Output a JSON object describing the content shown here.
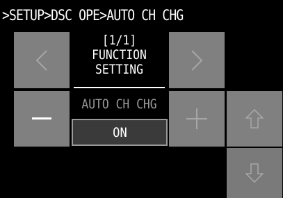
{
  "header": {
    "breadcrumb": ">SETUP>DSC OPE>AUTO CH CHG"
  },
  "page": {
    "indicator": "[1/1]",
    "title_line1": "FUNCTION",
    "title_line2": "SETTING"
  },
  "item": {
    "label": "AUTO CH CHG",
    "value": "ON"
  },
  "buttons": {
    "prev_icon": "chevron-left-icon",
    "next_icon": "chevron-right-icon",
    "minus_icon": "minus-icon",
    "plus_icon": "plus-icon",
    "up_icon": "arrow-up-icon",
    "down_icon": "arrow-down-icon"
  },
  "colors": {
    "background": "#000000",
    "button": "#808080",
    "disabled_glyph": "#a6a6a6",
    "text": "#ffffff",
    "dim_text": "#9a9a9a"
  }
}
